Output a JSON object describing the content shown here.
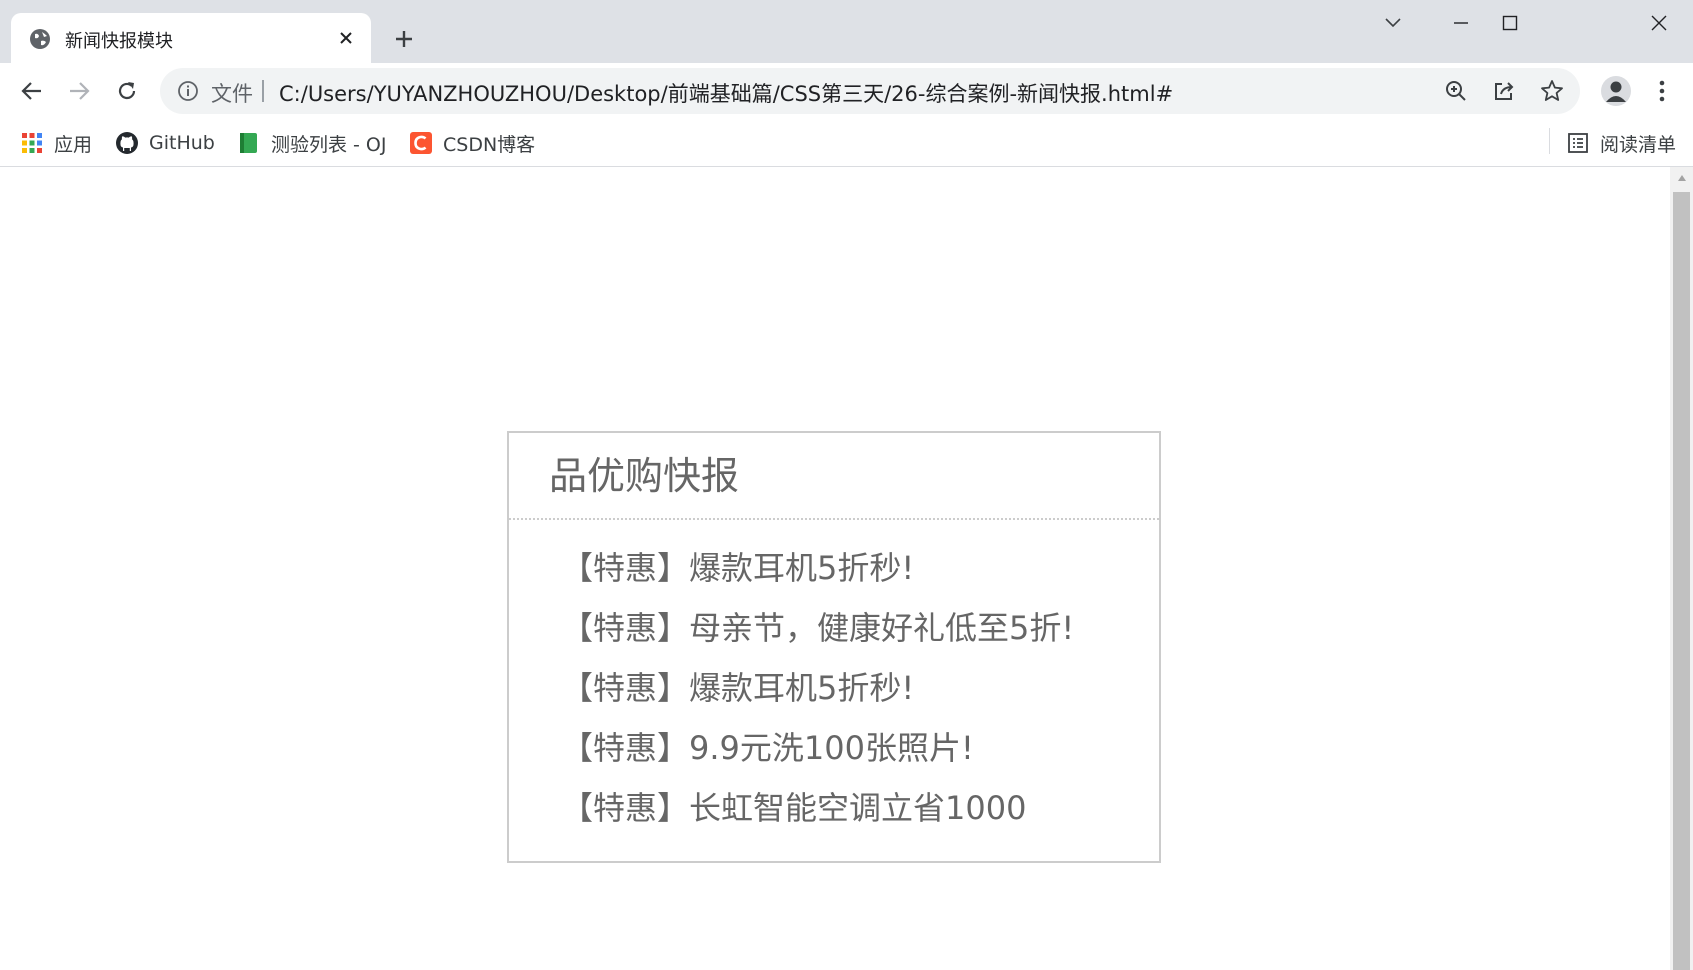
{
  "tab": {
    "title": "新闻快报模块"
  },
  "toolbar": {
    "scheme_label": "文件",
    "url": "C:/Users/YUYANZHOUZHOU/Desktop/前端基础篇/CSS第三天/26-综合案例-新闻快报.html#"
  },
  "bookmarks": {
    "items": [
      {
        "label": "应用",
        "icon": "apps-grid-icon"
      },
      {
        "label": "GitHub",
        "icon": "github-icon"
      },
      {
        "label": "测验列表 - OJ",
        "icon": "green-book-icon"
      },
      {
        "label": "CSDN博客",
        "icon": "csdn-icon"
      }
    ],
    "reading_list_label": "阅读清单"
  },
  "news": {
    "title": "品优购快报",
    "items": [
      "【特惠】爆款耳机5折秒!",
      "【特惠】母亲节，健康好礼低至5折!",
      "【特惠】爆款耳机5折秒!",
      "【特惠】9.9元洗100张照片!",
      "【特惠】长虹智能空调立省1000"
    ]
  },
  "colors": {
    "tabstrip_bg": "#dee1e6",
    "omnibox_bg": "#f1f3f4",
    "news_border": "#cccccc",
    "news_text": "#666666",
    "csdn_red": "#fc5531"
  }
}
